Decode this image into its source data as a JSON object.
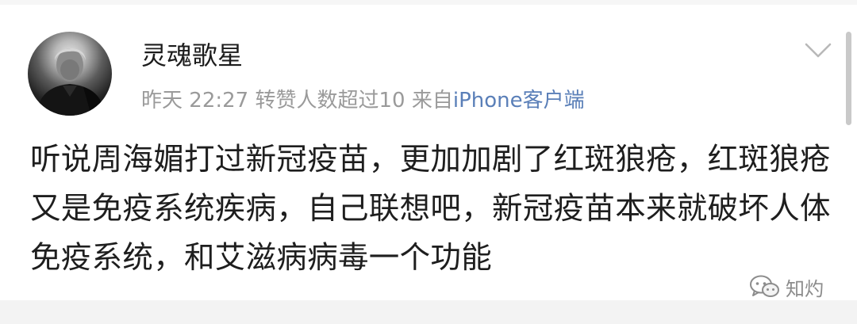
{
  "post": {
    "username": "灵魂歌星",
    "meta": {
      "date": "昨天",
      "time": "22:27",
      "reposts": "转赞人数超过10",
      "source_prefix": "来自",
      "client": "iPhone客户端"
    },
    "text": "听说周海媚打过新冠疫苗，更加加剧了红斑狼疮，红斑狼疮又是免疫系统疾病，自己联想吧，新冠疫苗本来就破坏人体免疫系统，和艾滋病病毒一个功能"
  },
  "watermark": {
    "text": "知灼"
  },
  "icons": {
    "more": "chevron-down-icon",
    "watermark": "wechat-icon"
  },
  "colors": {
    "meta": "#9a9a9a",
    "client_link": "#5a7fb8"
  }
}
